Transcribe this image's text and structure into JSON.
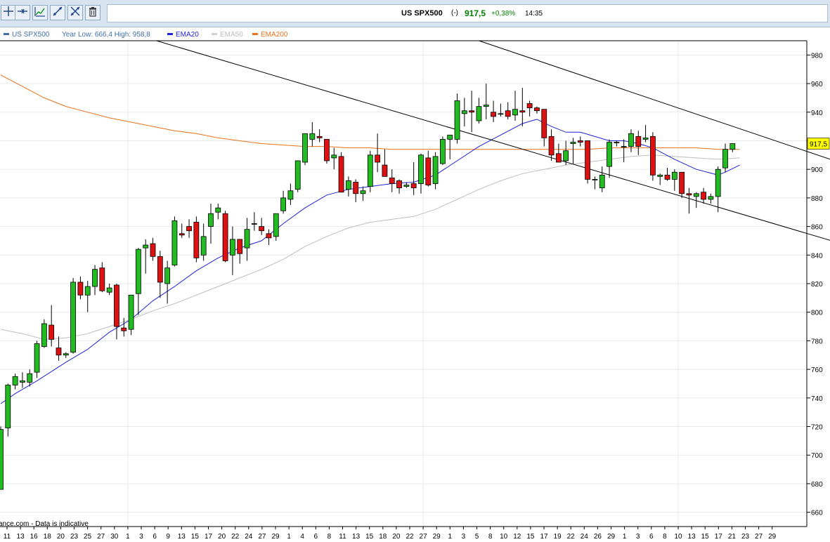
{
  "toolbar": {
    "tools": [
      {
        "name": "crosshair-tool-button",
        "icon": "crosshair-icon"
      },
      {
        "name": "horizontal-line-tool-button",
        "icon": "horizontal-line-icon"
      },
      {
        "name": "annotate-tool-button",
        "icon": "chart-pencil-icon"
      },
      {
        "name": "trendline-tool-button",
        "icon": "trendline-icon"
      },
      {
        "name": "fit-tool-button",
        "icon": "crossed-arrows-icon"
      },
      {
        "name": "delete-tool-button",
        "icon": "trash-icon"
      }
    ]
  },
  "header": {
    "symbol": "US SPX500",
    "flag": "(-)",
    "price": "917,5",
    "change": "+0,38%",
    "time": "14:35",
    "change_color": "#008000"
  },
  "legend": {
    "symbol": "US SPX500",
    "range": "Year Low: 666,4 High: 958,8",
    "items": [
      {
        "label": "EMA20",
        "color": "#1f24d6"
      },
      {
        "label": "EMA50",
        "color": "#bdbdbd"
      },
      {
        "label": "EMA200",
        "color": "#e8711a"
      }
    ],
    "symbol_color": "#3f6ea8"
  },
  "footer": {
    "source": "ance.com - Data is indicative"
  },
  "chart_data": {
    "type": "candlestick",
    "ylim": [
      650,
      990
    ],
    "yticks": [
      660,
      680,
      700,
      720,
      740,
      760,
      780,
      800,
      820,
      840,
      860,
      880,
      900,
      920,
      940,
      960,
      980
    ],
    "xticks": [
      "11",
      "13",
      "16",
      "18",
      "20",
      "23",
      "25",
      "27",
      "30",
      "1",
      "3",
      "6",
      "9",
      "13",
      "15",
      "17",
      "20",
      "22",
      "24",
      "27",
      "29",
      "1",
      "4",
      "6",
      "8",
      "11",
      "13",
      "15",
      "18",
      "20",
      "22",
      "27",
      "29",
      "1",
      "3",
      "5",
      "8",
      "10",
      "12",
      "15",
      "17",
      "19",
      "22",
      "24",
      "26",
      "29",
      "1",
      "3",
      "6",
      "8",
      "10",
      "13",
      "15",
      "17",
      "21",
      "23",
      "27",
      "29"
    ],
    "current_price": "917,5",
    "up_color": "#22bb22",
    "down_color": "#dd1111",
    "candles": [
      {
        "o": 676,
        "h": 720,
        "l": 676,
        "c": 718
      },
      {
        "o": 719,
        "h": 750,
        "l": 713,
        "c": 749
      },
      {
        "o": 749,
        "h": 757,
        "l": 746,
        "c": 755
      },
      {
        "o": 751,
        "h": 758,
        "l": 747,
        "c": 752
      },
      {
        "o": 751,
        "h": 760,
        "l": 748,
        "c": 757
      },
      {
        "o": 758,
        "h": 780,
        "l": 754,
        "c": 778
      },
      {
        "o": 776,
        "h": 795,
        "l": 775,
        "c": 792
      },
      {
        "o": 791,
        "h": 805,
        "l": 776,
        "c": 781
      },
      {
        "o": 775,
        "h": 783,
        "l": 766,
        "c": 770
      },
      {
        "o": 770,
        "h": 772,
        "l": 768,
        "c": 771
      },
      {
        "o": 772,
        "h": 824,
        "l": 771,
        "c": 821
      },
      {
        "o": 821,
        "h": 825,
        "l": 809,
        "c": 812
      },
      {
        "o": 812,
        "h": 822,
        "l": 800,
        "c": 818
      },
      {
        "o": 818,
        "h": 833,
        "l": 812,
        "c": 830
      },
      {
        "o": 831,
        "h": 835,
        "l": 814,
        "c": 815
      },
      {
        "o": 814,
        "h": 820,
        "l": 812,
        "c": 817
      },
      {
        "o": 819,
        "h": 820,
        "l": 781,
        "c": 790
      },
      {
        "o": 789,
        "h": 796,
        "l": 783,
        "c": 787
      },
      {
        "o": 788,
        "h": 812,
        "l": 784,
        "c": 812
      },
      {
        "o": 813,
        "h": 845,
        "l": 798,
        "c": 844
      },
      {
        "o": 845,
        "h": 851,
        "l": 827,
        "c": 847
      },
      {
        "o": 848,
        "h": 852,
        "l": 836,
        "c": 839
      },
      {
        "o": 839,
        "h": 843,
        "l": 810,
        "c": 821
      },
      {
        "o": 820,
        "h": 836,
        "l": 806,
        "c": 831
      },
      {
        "o": 833,
        "h": 867,
        "l": 832,
        "c": 864
      },
      {
        "o": 855,
        "h": 862,
        "l": 852,
        "c": 854
      },
      {
        "o": 860,
        "h": 865,
        "l": 852,
        "c": 857
      },
      {
        "o": 863,
        "h": 867,
        "l": 835,
        "c": 838
      },
      {
        "o": 840,
        "h": 862,
        "l": 836,
        "c": 853
      },
      {
        "o": 860,
        "h": 876,
        "l": 848,
        "c": 869
      },
      {
        "o": 870,
        "h": 876,
        "l": 865,
        "c": 873
      },
      {
        "o": 869,
        "h": 871,
        "l": 835,
        "c": 836
      },
      {
        "o": 840,
        "h": 860,
        "l": 826,
        "c": 851
      },
      {
        "o": 851,
        "h": 851,
        "l": 834,
        "c": 841
      },
      {
        "o": 845,
        "h": 866,
        "l": 836,
        "c": 858
      },
      {
        "o": 862,
        "h": 870,
        "l": 857,
        "c": 862
      },
      {
        "o": 860,
        "h": 866,
        "l": 854,
        "c": 857
      },
      {
        "o": 855,
        "h": 858,
        "l": 847,
        "c": 852
      },
      {
        "o": 853,
        "h": 868,
        "l": 850,
        "c": 869
      },
      {
        "o": 871,
        "h": 885,
        "l": 869,
        "c": 880
      },
      {
        "o": 879,
        "h": 890,
        "l": 875,
        "c": 885
      },
      {
        "o": 886,
        "h": 905,
        "l": 884,
        "c": 906
      },
      {
        "o": 905,
        "h": 925,
        "l": 903,
        "c": 925
      },
      {
        "o": 921,
        "h": 933,
        "l": 916,
        "c": 925
      },
      {
        "o": 923,
        "h": 928,
        "l": 919,
        "c": 922
      },
      {
        "o": 921,
        "h": 920,
        "l": 904,
        "c": 906
      },
      {
        "o": 908,
        "h": 915,
        "l": 900,
        "c": 910
      },
      {
        "o": 909,
        "h": 912,
        "l": 884,
        "c": 884
      },
      {
        "o": 886,
        "h": 895,
        "l": 881,
        "c": 892
      },
      {
        "o": 891,
        "h": 893,
        "l": 877,
        "c": 883
      },
      {
        "o": 883,
        "h": 888,
        "l": 878,
        "c": 885
      },
      {
        "o": 888,
        "h": 913,
        "l": 884,
        "c": 910
      },
      {
        "o": 910,
        "h": 925,
        "l": 898,
        "c": 905
      },
      {
        "o": 903,
        "h": 914,
        "l": 897,
        "c": 895
      },
      {
        "o": 894,
        "h": 900,
        "l": 884,
        "c": 890
      },
      {
        "o": 892,
        "h": 893,
        "l": 883,
        "c": 887
      },
      {
        "o": 888,
        "h": 891,
        "l": 887,
        "c": 889
      },
      {
        "o": 890,
        "h": 905,
        "l": 882,
        "c": 887
      },
      {
        "o": 890,
        "h": 911,
        "l": 883,
        "c": 910
      },
      {
        "o": 908,
        "h": 913,
        "l": 888,
        "c": 889
      },
      {
        "o": 890,
        "h": 912,
        "l": 886,
        "c": 909
      },
      {
        "o": 904,
        "h": 923,
        "l": 903,
        "c": 921
      },
      {
        "o": 921,
        "h": 924,
        "l": 907,
        "c": 924
      },
      {
        "o": 921,
        "h": 953,
        "l": 918,
        "c": 948
      },
      {
        "o": 939,
        "h": 950,
        "l": 930,
        "c": 941
      },
      {
        "o": 941,
        "h": 955,
        "l": 926,
        "c": 940
      },
      {
        "o": 934,
        "h": 950,
        "l": 932,
        "c": 944
      },
      {
        "o": 944,
        "h": 960,
        "l": 935,
        "c": 945
      },
      {
        "o": 940,
        "h": 948,
        "l": 933,
        "c": 937
      },
      {
        "o": 939,
        "h": 946,
        "l": 937,
        "c": 939
      },
      {
        "o": 941,
        "h": 947,
        "l": 935,
        "c": 937
      },
      {
        "o": 938,
        "h": 955,
        "l": 934,
        "c": 942
      },
      {
        "o": 941,
        "h": 957,
        "l": 930,
        "c": 940
      },
      {
        "o": 946,
        "h": 948,
        "l": 937,
        "c": 943
      },
      {
        "o": 943,
        "h": 944,
        "l": 939,
        "c": 941
      },
      {
        "o": 942,
        "h": 942,
        "l": 916,
        "c": 922
      },
      {
        "o": 923,
        "h": 928,
        "l": 906,
        "c": 910
      },
      {
        "o": 911,
        "h": 918,
        "l": 905,
        "c": 905
      },
      {
        "o": 906,
        "h": 920,
        "l": 903,
        "c": 913
      },
      {
        "o": 918,
        "h": 922,
        "l": 904,
        "c": 919
      },
      {
        "o": 920,
        "h": 923,
        "l": 916,
        "c": 919
      },
      {
        "o": 920,
        "h": 920,
        "l": 890,
        "c": 893
      },
      {
        "o": 893,
        "h": 895,
        "l": 886,
        "c": 893
      },
      {
        "o": 887,
        "h": 902,
        "l": 884,
        "c": 896
      },
      {
        "o": 902,
        "h": 921,
        "l": 894,
        "c": 919
      },
      {
        "o": 919,
        "h": 920,
        "l": 916,
        "c": 919
      },
      {
        "o": 916,
        "h": 921,
        "l": 905,
        "c": 916
      },
      {
        "o": 916,
        "h": 928,
        "l": 912,
        "c": 925
      },
      {
        "o": 923,
        "h": 927,
        "l": 910,
        "c": 916
      },
      {
        "o": 921,
        "h": 931,
        "l": 919,
        "c": 922
      },
      {
        "o": 923,
        "h": 926,
        "l": 892,
        "c": 896
      },
      {
        "o": 895,
        "h": 897,
        "l": 889,
        "c": 896
      },
      {
        "o": 896,
        "h": 901,
        "l": 892,
        "c": 893
      },
      {
        "o": 893,
        "h": 900,
        "l": 885,
        "c": 898
      },
      {
        "o": 898,
        "h": 898,
        "l": 880,
        "c": 883
      },
      {
        "o": 883,
        "h": 887,
        "l": 869,
        "c": 882
      },
      {
        "o": 881,
        "h": 884,
        "l": 873,
        "c": 883
      },
      {
        "o": 884,
        "h": 887,
        "l": 876,
        "c": 879
      },
      {
        "o": 879,
        "h": 883,
        "l": 876,
        "c": 881
      },
      {
        "o": 881,
        "h": 902,
        "l": 870,
        "c": 900
      },
      {
        "o": 901,
        "h": 918,
        "l": 898,
        "c": 914
      },
      {
        "o": 914,
        "h": 918,
        "l": 912,
        "c": 918
      }
    ],
    "ema20": [
      [
        0,
        736
      ],
      [
        2,
        743
      ],
      [
        5,
        752
      ],
      [
        9,
        765
      ],
      [
        12,
        774
      ],
      [
        15,
        786
      ],
      [
        18,
        795
      ],
      [
        21,
        808
      ],
      [
        24,
        818
      ],
      [
        27,
        829
      ],
      [
        30,
        838
      ],
      [
        33,
        845
      ],
      [
        36,
        850
      ],
      [
        39,
        862
      ],
      [
        42,
        873
      ],
      [
        45,
        882
      ],
      [
        48,
        886
      ],
      [
        51,
        888
      ],
      [
        54,
        890
      ],
      [
        57,
        891
      ],
      [
        60,
        896
      ],
      [
        63,
        906
      ],
      [
        66,
        916
      ],
      [
        69,
        924
      ],
      [
        72,
        932
      ],
      [
        74,
        935
      ],
      [
        76,
        930
      ],
      [
        78,
        926
      ],
      [
        80,
        926
      ],
      [
        82,
        923
      ],
      [
        84,
        920
      ],
      [
        86,
        920
      ],
      [
        88,
        918
      ],
      [
        90,
        915
      ],
      [
        93,
        907
      ],
      [
        96,
        900
      ],
      [
        99,
        896
      ],
      [
        100,
        898
      ],
      [
        102,
        903
      ]
    ],
    "ema50": [
      [
        0,
        788
      ],
      [
        3,
        785
      ],
      [
        6,
        781
      ],
      [
        9,
        782
      ],
      [
        12,
        785
      ],
      [
        15,
        790
      ],
      [
        18,
        795
      ],
      [
        21,
        801
      ],
      [
        24,
        806
      ],
      [
        27,
        812
      ],
      [
        30,
        818
      ],
      [
        33,
        824
      ],
      [
        36,
        830
      ],
      [
        39,
        837
      ],
      [
        42,
        846
      ],
      [
        45,
        853
      ],
      [
        48,
        859
      ],
      [
        51,
        863
      ],
      [
        54,
        865
      ],
      [
        57,
        867
      ],
      [
        60,
        872
      ],
      [
        63,
        879
      ],
      [
        66,
        886
      ],
      [
        69,
        892
      ],
      [
        72,
        897
      ],
      [
        75,
        900
      ],
      [
        78,
        903
      ],
      [
        81,
        905
      ],
      [
        84,
        907
      ],
      [
        87,
        909
      ],
      [
        90,
        910
      ],
      [
        93,
        909
      ],
      [
        96,
        908
      ],
      [
        99,
        907
      ],
      [
        102,
        908
      ]
    ],
    "ema200": [
      [
        0,
        966
      ],
      [
        3,
        958
      ],
      [
        6,
        950
      ],
      [
        9,
        944
      ],
      [
        12,
        940
      ],
      [
        15,
        936
      ],
      [
        18,
        933
      ],
      [
        21,
        930
      ],
      [
        24,
        927
      ],
      [
        27,
        925
      ],
      [
        30,
        922
      ],
      [
        33,
        920
      ],
      [
        36,
        918
      ],
      [
        39,
        917
      ],
      [
        42,
        916
      ],
      [
        45,
        916
      ],
      [
        48,
        915
      ],
      [
        51,
        915
      ],
      [
        54,
        914
      ],
      [
        57,
        914
      ],
      [
        60,
        914
      ],
      [
        63,
        914
      ],
      [
        66,
        914
      ],
      [
        69,
        914
      ],
      [
        72,
        914
      ],
      [
        75,
        914
      ],
      [
        78,
        914
      ],
      [
        81,
        914
      ],
      [
        84,
        915
      ],
      [
        87,
        915
      ],
      [
        90,
        915
      ],
      [
        93,
        915
      ],
      [
        96,
        915
      ],
      [
        99,
        914
      ],
      [
        102,
        914
      ]
    ],
    "trendlines": [
      {
        "from": [
          21.5,
          990
        ],
        "to": [
          118,
          845
        ]
      },
      {
        "from": [
          66,
          990
        ],
        "to": [
          118,
          901
        ]
      }
    ]
  }
}
